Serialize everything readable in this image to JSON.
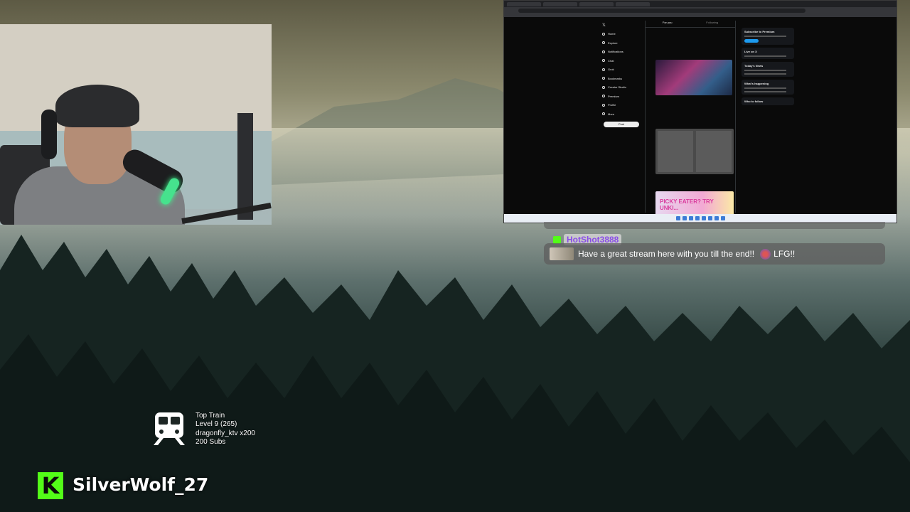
{
  "chat": {
    "username": "HotShot3888",
    "message": "Have a great stream here with you till the end!!",
    "trailing_text": "LFG!!",
    "badge_color": "#53fc18",
    "username_color": "#8a4de8"
  },
  "train": {
    "title": "Top Train",
    "level": "Level 9  (265)",
    "top_gifter": "dragonfly_ktv x200",
    "subs": "200 Subs",
    "icon": "train-icon"
  },
  "channel": {
    "logo_letter": "K",
    "name": "SilverWolf_27",
    "brand_color": "#53fc18"
  },
  "screen": {
    "nav_items": [
      "Home",
      "Explore",
      "Notifications",
      "Chat",
      "Grok",
      "Bookmarks",
      "Creator Studio",
      "Premium",
      "Profile",
      "More"
    ],
    "post_button": "Post",
    "feed_tabs": [
      "For you",
      "Following"
    ],
    "right_headers": [
      "Subscribe to Premium",
      "Live on X",
      "Today's News",
      "What's happening",
      "Who to follow"
    ],
    "ad_text": "PICKY EATER? TRY UNKI..."
  }
}
